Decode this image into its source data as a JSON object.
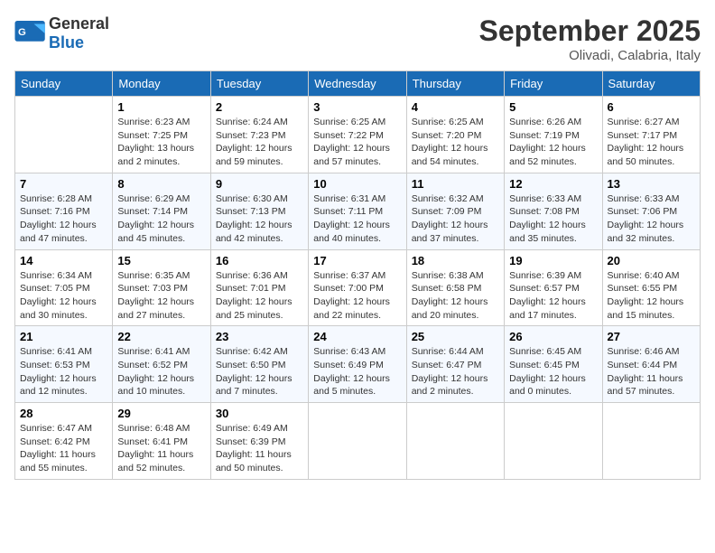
{
  "header": {
    "logo_general": "General",
    "logo_blue": "Blue",
    "month_title": "September 2025",
    "location": "Olivadi, Calabria, Italy"
  },
  "days_of_week": [
    "Sunday",
    "Monday",
    "Tuesday",
    "Wednesday",
    "Thursday",
    "Friday",
    "Saturday"
  ],
  "weeks": [
    [
      {
        "day": "",
        "info": ""
      },
      {
        "day": "1",
        "info": "Sunrise: 6:23 AM\nSunset: 7:25 PM\nDaylight: 13 hours\nand 2 minutes."
      },
      {
        "day": "2",
        "info": "Sunrise: 6:24 AM\nSunset: 7:23 PM\nDaylight: 12 hours\nand 59 minutes."
      },
      {
        "day": "3",
        "info": "Sunrise: 6:25 AM\nSunset: 7:22 PM\nDaylight: 12 hours\nand 57 minutes."
      },
      {
        "day": "4",
        "info": "Sunrise: 6:25 AM\nSunset: 7:20 PM\nDaylight: 12 hours\nand 54 minutes."
      },
      {
        "day": "5",
        "info": "Sunrise: 6:26 AM\nSunset: 7:19 PM\nDaylight: 12 hours\nand 52 minutes."
      },
      {
        "day": "6",
        "info": "Sunrise: 6:27 AM\nSunset: 7:17 PM\nDaylight: 12 hours\nand 50 minutes."
      }
    ],
    [
      {
        "day": "7",
        "info": "Sunrise: 6:28 AM\nSunset: 7:16 PM\nDaylight: 12 hours\nand 47 minutes."
      },
      {
        "day": "8",
        "info": "Sunrise: 6:29 AM\nSunset: 7:14 PM\nDaylight: 12 hours\nand 45 minutes."
      },
      {
        "day": "9",
        "info": "Sunrise: 6:30 AM\nSunset: 7:13 PM\nDaylight: 12 hours\nand 42 minutes."
      },
      {
        "day": "10",
        "info": "Sunrise: 6:31 AM\nSunset: 7:11 PM\nDaylight: 12 hours\nand 40 minutes."
      },
      {
        "day": "11",
        "info": "Sunrise: 6:32 AM\nSunset: 7:09 PM\nDaylight: 12 hours\nand 37 minutes."
      },
      {
        "day": "12",
        "info": "Sunrise: 6:33 AM\nSunset: 7:08 PM\nDaylight: 12 hours\nand 35 minutes."
      },
      {
        "day": "13",
        "info": "Sunrise: 6:33 AM\nSunset: 7:06 PM\nDaylight: 12 hours\nand 32 minutes."
      }
    ],
    [
      {
        "day": "14",
        "info": "Sunrise: 6:34 AM\nSunset: 7:05 PM\nDaylight: 12 hours\nand 30 minutes."
      },
      {
        "day": "15",
        "info": "Sunrise: 6:35 AM\nSunset: 7:03 PM\nDaylight: 12 hours\nand 27 minutes."
      },
      {
        "day": "16",
        "info": "Sunrise: 6:36 AM\nSunset: 7:01 PM\nDaylight: 12 hours\nand 25 minutes."
      },
      {
        "day": "17",
        "info": "Sunrise: 6:37 AM\nSunset: 7:00 PM\nDaylight: 12 hours\nand 22 minutes."
      },
      {
        "day": "18",
        "info": "Sunrise: 6:38 AM\nSunset: 6:58 PM\nDaylight: 12 hours\nand 20 minutes."
      },
      {
        "day": "19",
        "info": "Sunrise: 6:39 AM\nSunset: 6:57 PM\nDaylight: 12 hours\nand 17 minutes."
      },
      {
        "day": "20",
        "info": "Sunrise: 6:40 AM\nSunset: 6:55 PM\nDaylight: 12 hours\nand 15 minutes."
      }
    ],
    [
      {
        "day": "21",
        "info": "Sunrise: 6:41 AM\nSunset: 6:53 PM\nDaylight: 12 hours\nand 12 minutes."
      },
      {
        "day": "22",
        "info": "Sunrise: 6:41 AM\nSunset: 6:52 PM\nDaylight: 12 hours\nand 10 minutes."
      },
      {
        "day": "23",
        "info": "Sunrise: 6:42 AM\nSunset: 6:50 PM\nDaylight: 12 hours\nand 7 minutes."
      },
      {
        "day": "24",
        "info": "Sunrise: 6:43 AM\nSunset: 6:49 PM\nDaylight: 12 hours\nand 5 minutes."
      },
      {
        "day": "25",
        "info": "Sunrise: 6:44 AM\nSunset: 6:47 PM\nDaylight: 12 hours\nand 2 minutes."
      },
      {
        "day": "26",
        "info": "Sunrise: 6:45 AM\nSunset: 6:45 PM\nDaylight: 12 hours\nand 0 minutes."
      },
      {
        "day": "27",
        "info": "Sunrise: 6:46 AM\nSunset: 6:44 PM\nDaylight: 11 hours\nand 57 minutes."
      }
    ],
    [
      {
        "day": "28",
        "info": "Sunrise: 6:47 AM\nSunset: 6:42 PM\nDaylight: 11 hours\nand 55 minutes."
      },
      {
        "day": "29",
        "info": "Sunrise: 6:48 AM\nSunset: 6:41 PM\nDaylight: 11 hours\nand 52 minutes."
      },
      {
        "day": "30",
        "info": "Sunrise: 6:49 AM\nSunset: 6:39 PM\nDaylight: 11 hours\nand 50 minutes."
      },
      {
        "day": "",
        "info": ""
      },
      {
        "day": "",
        "info": ""
      },
      {
        "day": "",
        "info": ""
      },
      {
        "day": "",
        "info": ""
      }
    ]
  ]
}
